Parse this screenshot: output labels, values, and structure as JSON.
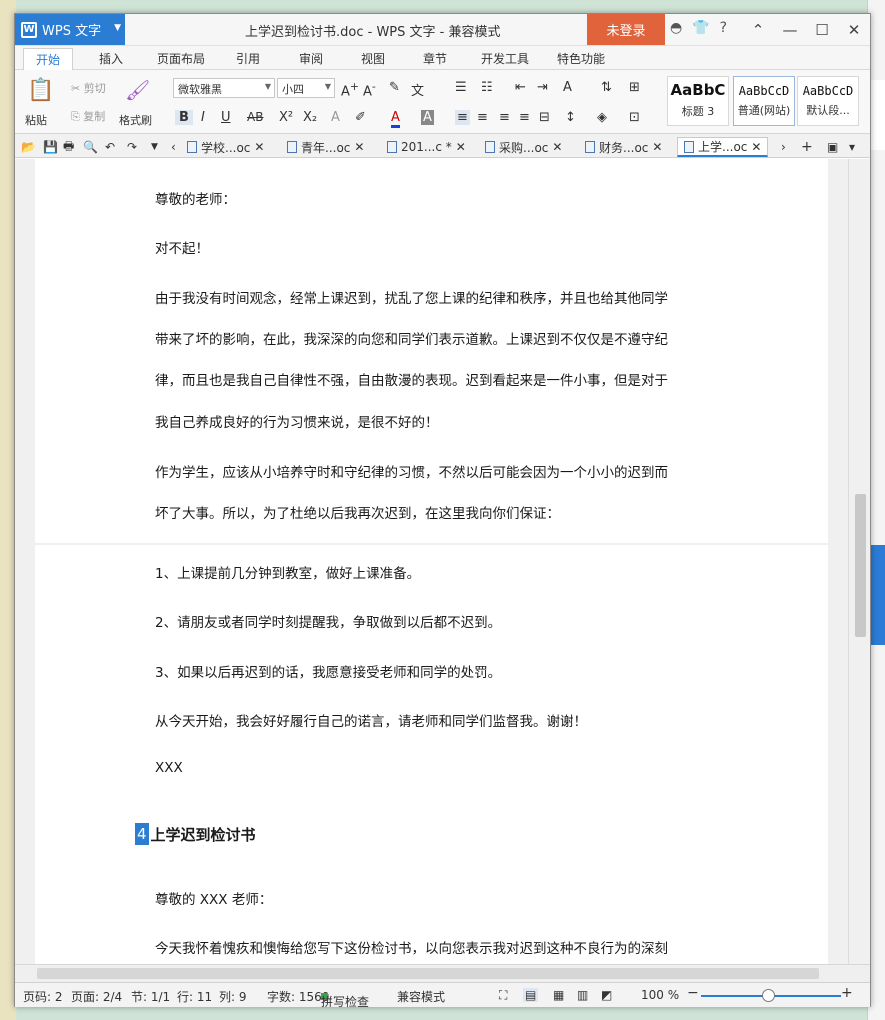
{
  "app": {
    "button_label": "WPS 文字",
    "window_title": "上学迟到检讨书.doc - WPS 文字 - 兼容模式",
    "login_label": "未登录",
    "accent_color": "#2b7cd3",
    "login_color": "#e0633c"
  },
  "menu": [
    "开始",
    "插入",
    "页面布局",
    "引用",
    "审阅",
    "视图",
    "章节",
    "开发工具",
    "特色功能"
  ],
  "ribbon": {
    "paste": "粘贴",
    "cut": "剪切",
    "copy": "复制",
    "format_painter": "格式刷",
    "font_name": "微软雅黑",
    "font_size": "小四",
    "styles": [
      {
        "preview": "AaBbC",
        "label": "标题 3"
      },
      {
        "preview": "AaBbCcD",
        "label": "普通(网站)"
      },
      {
        "preview": "AaBbCcD",
        "label": "默认段..."
      }
    ]
  },
  "doc_tabs": [
    "学校...oc",
    "青年...oc",
    "201...c *",
    "采购...oc",
    "财务...oc",
    "上学...oc"
  ],
  "document": {
    "page1": [
      "尊敬的老师：",
      "对不起！",
      "由于我没有时间观念，经常上课迟到，扰乱了您上课的纪律和秩序，并且也给其他同学",
      "带来了坏的影响，在此，我深深的向您和同学们表示道歉。上课迟到不仅仅是不遵守纪",
      "律，而且也是我自己自律性不强，自由散漫的表现。迟到看起来是一件小事，但是对于",
      "我自己养成良好的行为习惯来说，是很不好的！",
      "作为学生，应该从小培养守时和守纪律的习惯，不然以后可能会因为一个小小的迟到而",
      "坏了大事。所以，为了杜绝以后我再次迟到，在这里我向你们保证："
    ],
    "page2": [
      "1、上课提前几分钟到教室，做好上课准备。",
      "2、请朋友或者同学时刻提醒我，争取做到以后都不迟到。",
      "3、如果以后再迟到的话，我愿意接受老师和同学的处罚。",
      "从今天开始，我会好好履行自己的诺言，请老师和同学们监督我。谢谢！",
      "XXX"
    ],
    "heading_number": "4",
    "heading_text": "上学迟到检讨书",
    "page2_after": [
      "尊敬的 XXX 老师：",
      "今天我怀着愧疚和懊悔给您写下这份检讨书，以向您表示我对迟到这种不良行为的深刻"
    ]
  },
  "status": {
    "page_code": "页码: 2",
    "pages": "页面: 2/4",
    "section": "节: 1/1",
    "row": "行: 11",
    "col": "列: 9",
    "word_count": "字数: 1560",
    "spell_check": "拼写检查",
    "compat": "兼容模式",
    "zoom": "100 %"
  }
}
